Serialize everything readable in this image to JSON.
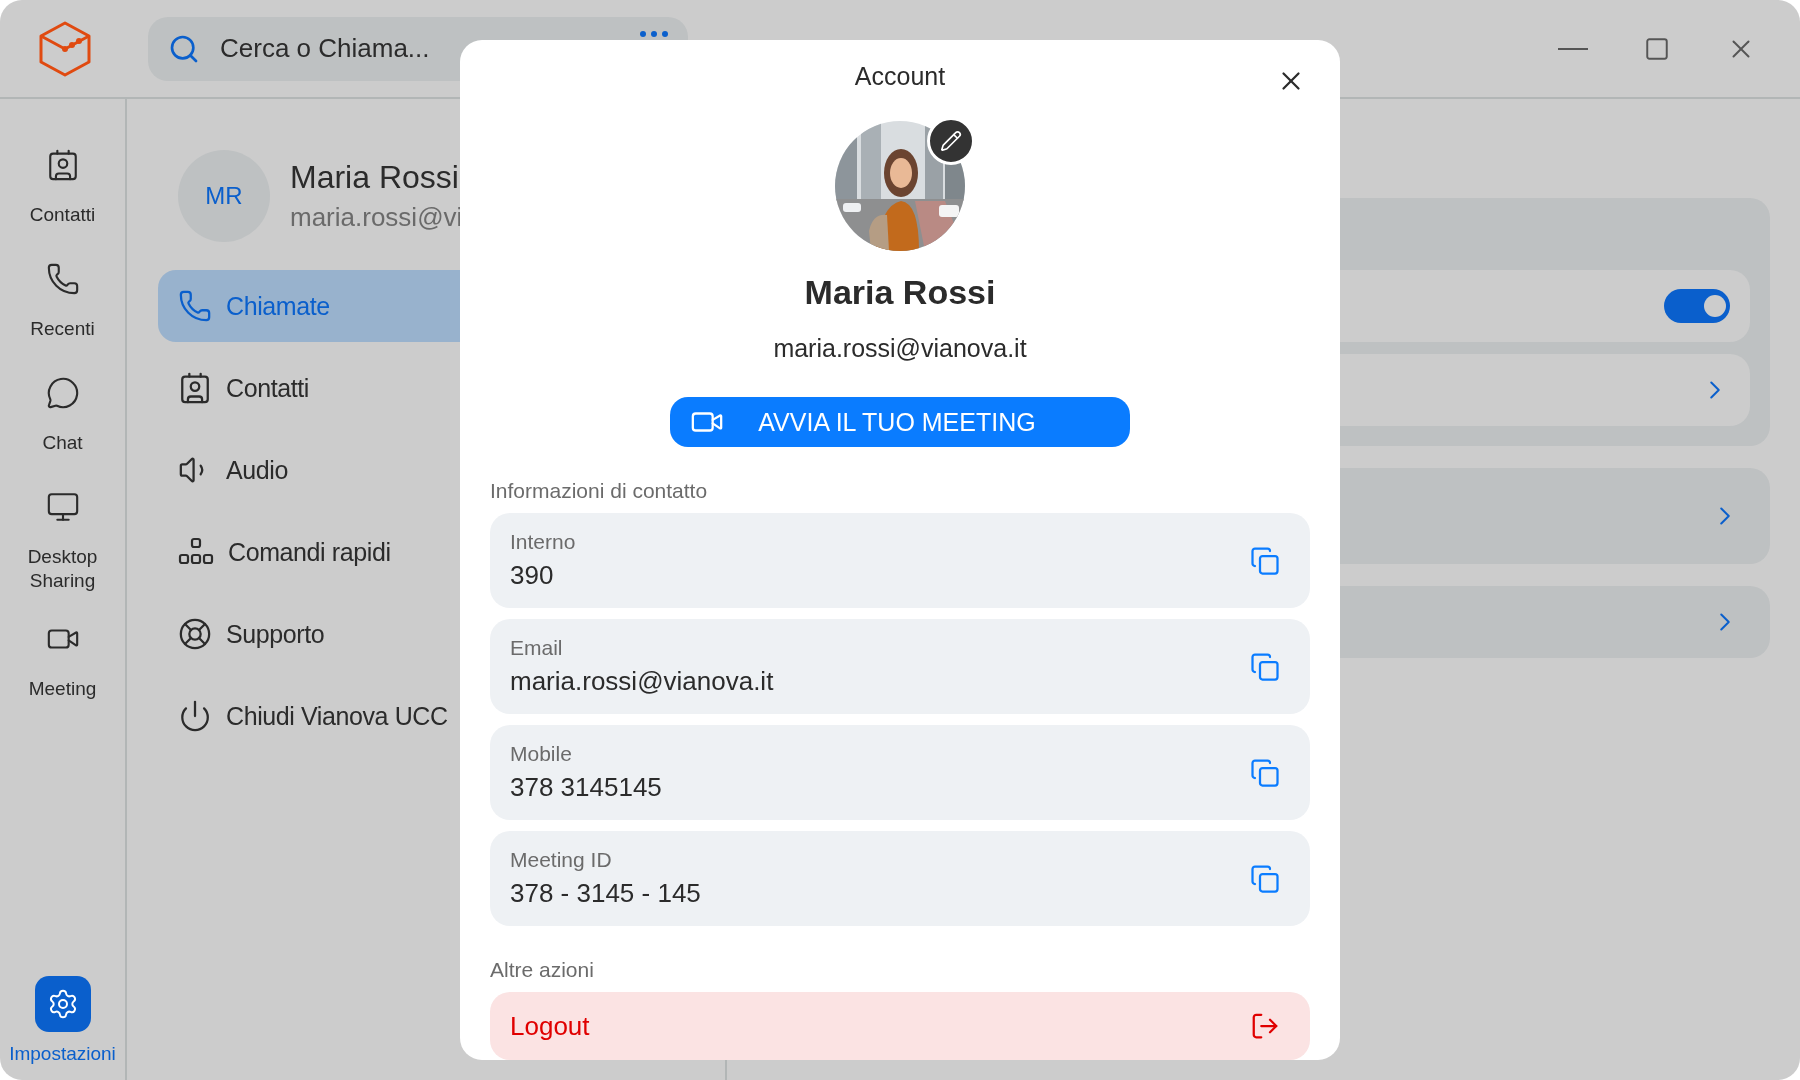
{
  "search": {
    "placeholder": "Cerca o Chiama..."
  },
  "rail": [
    {
      "label": "Contatti",
      "selected": false
    },
    {
      "label": "Recenti",
      "selected": false
    },
    {
      "label": "Chat",
      "selected": false
    },
    {
      "label": "Desktop Sharing",
      "selected": false
    },
    {
      "label": "Meeting",
      "selected": false
    },
    {
      "label": "Impostazioni",
      "selected": true
    }
  ],
  "profile": {
    "initials": "MR",
    "name": "Maria Rossi",
    "email": "maria.rossi@vi"
  },
  "settings_menu": [
    {
      "label": "Chiamate",
      "selected": true
    },
    {
      "label": "Contatti",
      "selected": false
    },
    {
      "label": "Audio",
      "selected": false
    },
    {
      "label": "Comandi rapidi",
      "selected": false
    },
    {
      "label": "Supporto",
      "selected": false
    },
    {
      "label": "Chiudi Vianova UCC",
      "selected": false
    }
  ],
  "settings_panel": {
    "toggle": {
      "on": true
    }
  },
  "dialog": {
    "title": "Account",
    "name": "Maria Rossi",
    "email": "maria.rossi@vianova.it",
    "meeting_button": "AVVIA IL TUO MEETING",
    "contact_section": "Informazioni di contatto",
    "contacts": [
      {
        "label": "Interno",
        "value": "390"
      },
      {
        "label": "Email",
        "value": "maria.rossi@vianova.it"
      },
      {
        "label": "Mobile",
        "value": "378 3145145"
      },
      {
        "label": "Meeting ID",
        "value": "378 - 3145 - 145"
      }
    ],
    "actions_section": "Altre azioni",
    "actions": [
      {
        "label": "Logout"
      }
    ]
  }
}
